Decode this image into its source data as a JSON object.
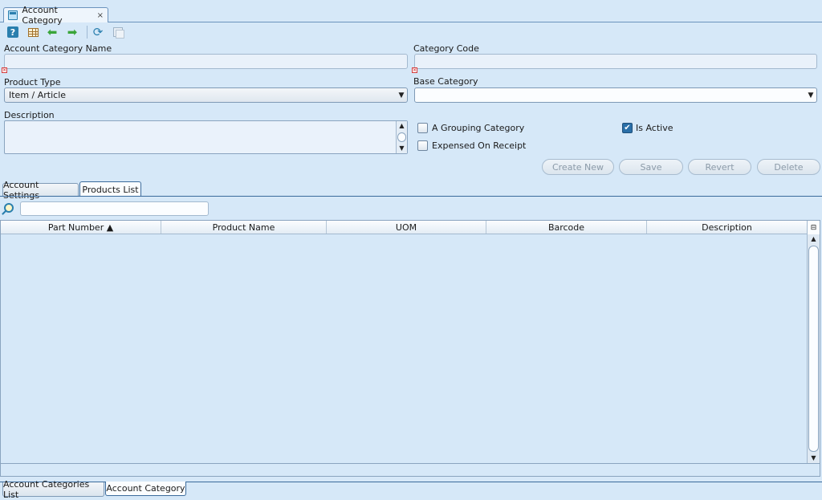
{
  "window_tab": {
    "title": "Account Category",
    "close_glyph": "×",
    "icon": "window-icon"
  },
  "toolbar": {
    "icons": [
      "help-icon",
      "grid-icon",
      "back-arrow-icon",
      "forward-arrow-icon",
      "refresh-icon",
      "copy-icon"
    ],
    "help_glyph": "?",
    "back_glyph": "⬅",
    "forward_glyph": "➡",
    "refresh_glyph": "⟳"
  },
  "form": {
    "name_label": "Account Category Name",
    "name_value": "",
    "code_label": "Category Code",
    "code_value": "",
    "error_glyph": "×",
    "product_type_label": "Product Type",
    "product_type_value": "Item / Article",
    "base_category_label": "Base Category",
    "base_category_value": "",
    "description_label": "Description",
    "description_value": "",
    "grouping_label": "A Grouping Category",
    "grouping_checked": false,
    "expensed_label": "Expensed On Receipt",
    "expensed_checked": false,
    "active_label": "Is Active",
    "active_checked": true,
    "check_glyph": "✔",
    "chevron_glyph": "▼"
  },
  "actions": {
    "create_new": "Create New",
    "save": "Save",
    "revert": "Revert",
    "delete": "Delete"
  },
  "inner_tabs": [
    {
      "label": "Account Settings",
      "active": false
    },
    {
      "label": "Products List",
      "active": true
    }
  ],
  "products_table": {
    "search_value": "",
    "columns": [
      "Part Number ▲",
      "Product Name",
      "UOM",
      "Barcode",
      "Description"
    ],
    "rows": [],
    "corner_glyph": "⊟",
    "scroll_up_glyph": "▲",
    "scroll_down_glyph": "▼"
  },
  "bottom_tabs": [
    {
      "label": "Account Categories List",
      "active": false
    },
    {
      "label": "Account Category",
      "active": true
    }
  ],
  "colors": {
    "background": "#d6e8f8",
    "accent": "#2a7fae",
    "border": "#3b6b9c"
  }
}
